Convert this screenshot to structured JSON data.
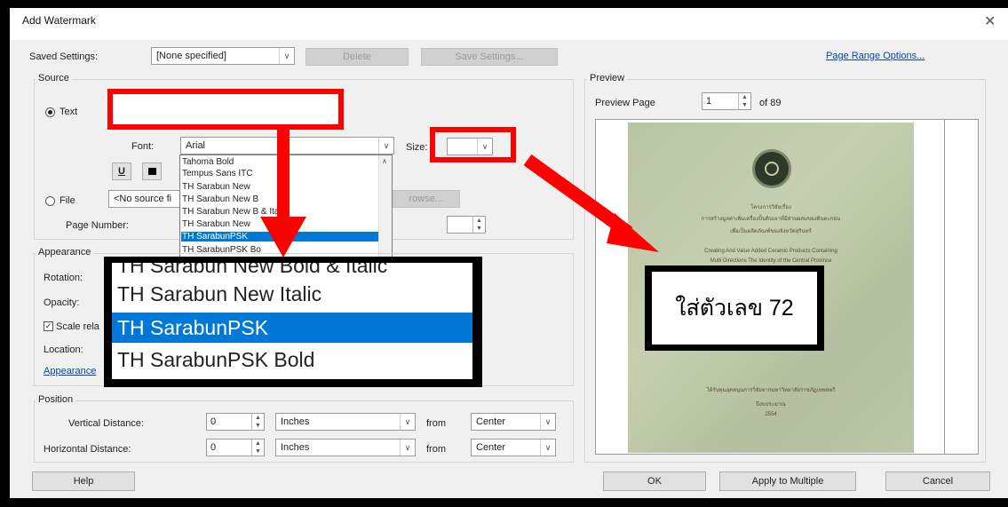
{
  "window": {
    "title": "Add Watermark",
    "close_glyph": "✕"
  },
  "saved_settings": {
    "label": "Saved Settings:",
    "value": "[None specified]",
    "delete_label": "Delete",
    "save_label": "Save Settings..."
  },
  "page_range_link": "Page Range Options...",
  "source": {
    "group_label": "Source",
    "text_radio_label": "Text",
    "font_label": "Font:",
    "font_value": "Arial",
    "size_label": "Size:",
    "size_value": "",
    "file_radio_label": "File",
    "file_value": "<No source fi",
    "browse_label": "rowse...",
    "page_number_label": "Page Number:",
    "font_list": [
      {
        "label": "Tahoma Bold"
      },
      {
        "label": "Tempus Sans ITC"
      },
      {
        "label": "TH Sarabun New"
      },
      {
        "label": "TH Sarabun New B"
      },
      {
        "label": "TH Sarabun New B   & Italic"
      },
      {
        "label": "TH Sarabun New"
      },
      {
        "label": "TH SarabunPSK",
        "selected": true
      },
      {
        "label": "TH SarabunPSK Bo"
      }
    ]
  },
  "appearance": {
    "group_label": "Appearance",
    "rotation_label": "Rotation:",
    "opacity_label": "Opacity:",
    "scale_label": "Scale rela",
    "location_label": "Location:",
    "options_link": "Appearance"
  },
  "zoom": {
    "items": [
      {
        "label": "TH Sarabun New Bold & Italic"
      },
      {
        "label": "TH Sarabun New Italic"
      },
      {
        "label": "TH SarabunPSK",
        "selected": true
      },
      {
        "label": "TH SarabunPSK Bold"
      }
    ]
  },
  "annotation": {
    "text": "ใส่ตัวเลข 72"
  },
  "position": {
    "group_label": "Position",
    "vertical_label": "Vertical Distance:",
    "vertical_value": "0",
    "vertical_unit": "Inches",
    "vertical_from_label": "from",
    "vertical_from_value": "Center",
    "horizontal_label": "Horizontal Distance:",
    "horizontal_value": "0",
    "horizontal_unit": "Inches",
    "horizontal_from_label": "from",
    "horizontal_from_value": "Center"
  },
  "preview": {
    "group_label": "Preview",
    "page_label": "Preview Page",
    "page_value": "1",
    "of_label": "of 89",
    "doc_lines": [
      "โครงการวิจัยเรื่อง",
      "การสร้างมูลค่าเพิ่มเครื่องปั้นดินเผาที่มีส่วนผสมของดินตะกอน",
      "เพื่อเป็นผลิตภัณฑ์ของจังหวัดสุรินทร์",
      "Creating And Value Added Ceramic Products Containing",
      "Multi Directions The Identity of the Central Province",
      "ได้รับทุนอุดหนุนการวิจัยจากมหาวิทยาลัยราชภัฏเทพสตรี",
      "ปีงบประมาณ",
      "2554"
    ]
  },
  "footer": {
    "help_label": "Help",
    "ok_label": "OK",
    "apply_multiple_label": "Apply to Multiple",
    "cancel_label": "Cancel"
  },
  "colors": {
    "annotation_red": "#ff0000",
    "selection_blue": "#0078d7",
    "link_blue": "#0645ad"
  }
}
